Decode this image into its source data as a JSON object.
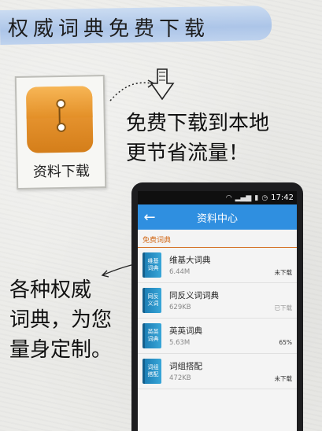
{
  "banner": {
    "title": "权威词典免费下载",
    "accent": "#a9c3e8"
  },
  "download_card": {
    "label": "资料下载",
    "icon": "envelope-icon"
  },
  "notes": {
    "line1": "免费下载到本地",
    "line2": "更节省流量！",
    "side_line1": "各种权威",
    "side_line2": "词典，为您",
    "side_line3": "量身定制。"
  },
  "phone": {
    "status_time": "17:42",
    "app_title": "资料中心",
    "accent": "#2f8fe0",
    "section_title": "免费词典",
    "items": [
      {
        "cover": "维基\n词典",
        "name": "维基大词典",
        "size": "6.44M",
        "status": "未下载"
      },
      {
        "cover": "同反\n义词",
        "name": "同反义词词典",
        "size": "629KB",
        "status": "已下载"
      },
      {
        "cover": "英英\n词典",
        "name": "英英词典",
        "size": "5.63M",
        "status": "65%"
      },
      {
        "cover": "词组\n搭配",
        "name": "词组搭配",
        "size": "472KB",
        "status": "未下载"
      }
    ]
  }
}
